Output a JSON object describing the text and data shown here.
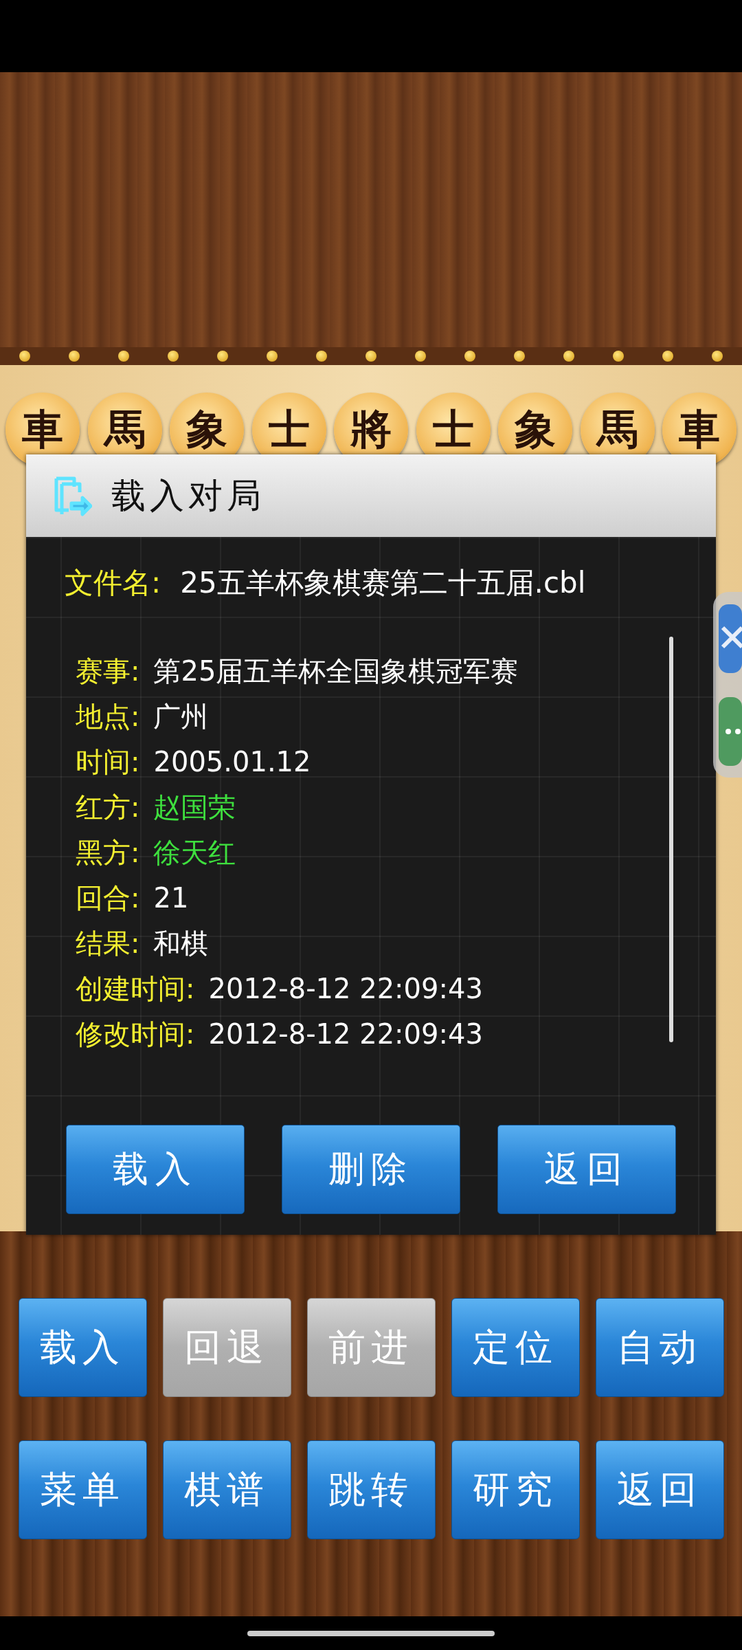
{
  "top_pieces": [
    "車",
    "馬",
    "象",
    "士",
    "將",
    "士",
    "象",
    "馬",
    "車"
  ],
  "dialog": {
    "title": "载入对局",
    "file_name": {
      "label": "文件名:",
      "value": "25五羊杯象棋赛第二十五届.cbl"
    },
    "fields": [
      {
        "label": "赛事:",
        "value": "第25届五羊杯全国象棋冠军赛",
        "color": "#ffffff"
      },
      {
        "label": "地点:",
        "value": "广州",
        "color": "#ffffff"
      },
      {
        "label": "时间:",
        "value": "2005.01.12",
        "color": "#ffffff"
      },
      {
        "label": "红方:",
        "value": "赵国荣",
        "color": "#3ee03e"
      },
      {
        "label": "黑方:",
        "value": "徐天红",
        "color": "#3ee03e"
      },
      {
        "label": "回合:",
        "value": "21",
        "color": "#ffffff"
      },
      {
        "label": "结果:",
        "value": "和棋",
        "color": "#ffffff"
      },
      {
        "label": "创建时间:",
        "value": "2012-8-12 22:09:43",
        "color": "#ffffff"
      },
      {
        "label": "修改时间:",
        "value": "2012-8-12 22:09:43",
        "color": "#ffffff"
      }
    ],
    "buttons": [
      "载入",
      "删除",
      "返回"
    ]
  },
  "controls": [
    {
      "label": "载入",
      "disabled": false
    },
    {
      "label": "回退",
      "disabled": true
    },
    {
      "label": "前进",
      "disabled": true
    },
    {
      "label": "定位",
      "disabled": false
    },
    {
      "label": "自动",
      "disabled": false
    },
    {
      "label": "菜单",
      "disabled": false
    },
    {
      "label": "棋谱",
      "disabled": false
    },
    {
      "label": "跳转",
      "disabled": false
    },
    {
      "label": "研究",
      "disabled": false
    },
    {
      "label": "返回",
      "disabled": false
    }
  ]
}
